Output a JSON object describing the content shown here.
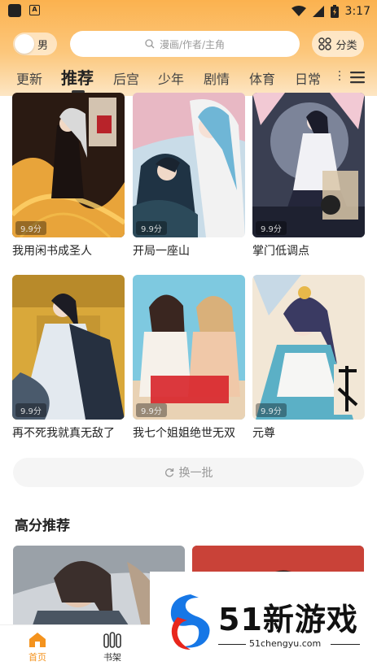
{
  "status_bar": {
    "time": "3:17",
    "icons": [
      "app-square-icon",
      "a-notification-icon",
      "wifi-icon",
      "signal-icon",
      "battery-icon"
    ]
  },
  "header": {
    "gender_label": "男",
    "search_placeholder": "漫画/作者/主角",
    "category_label": "分类",
    "tabs": [
      {
        "label": "更新"
      },
      {
        "label": "推荐"
      },
      {
        "label": "后宫"
      },
      {
        "label": "少年"
      },
      {
        "label": "剧情"
      },
      {
        "label": "体育"
      },
      {
        "label": "日常"
      }
    ],
    "active_tab": "推荐"
  },
  "comics": [
    {
      "title": "我用闲书成圣人",
      "score": "9.9分"
    },
    {
      "title": "开局一座山",
      "score": "9.9分"
    },
    {
      "title": "掌门低调点",
      "score": "9.9分"
    },
    {
      "title": "再不死我就真无敌了",
      "score": "9.9分"
    },
    {
      "title": "我七个姐姐绝世无双",
      "score": "9.9分"
    },
    {
      "title": "元尊",
      "score": "9.9分"
    }
  ],
  "refresh_label": "换一批",
  "high_score_section": {
    "title": "高分推荐"
  },
  "bottom_nav": [
    {
      "label": "首页",
      "active": true
    },
    {
      "label": "书架",
      "active": false
    }
  ],
  "watermark": {
    "text": "51新游戏",
    "url": "51chengyu.com"
  },
  "colors": {
    "accent": "#f4931e",
    "header_top": "#fbb24f",
    "header_bottom": "#fde6c4"
  }
}
